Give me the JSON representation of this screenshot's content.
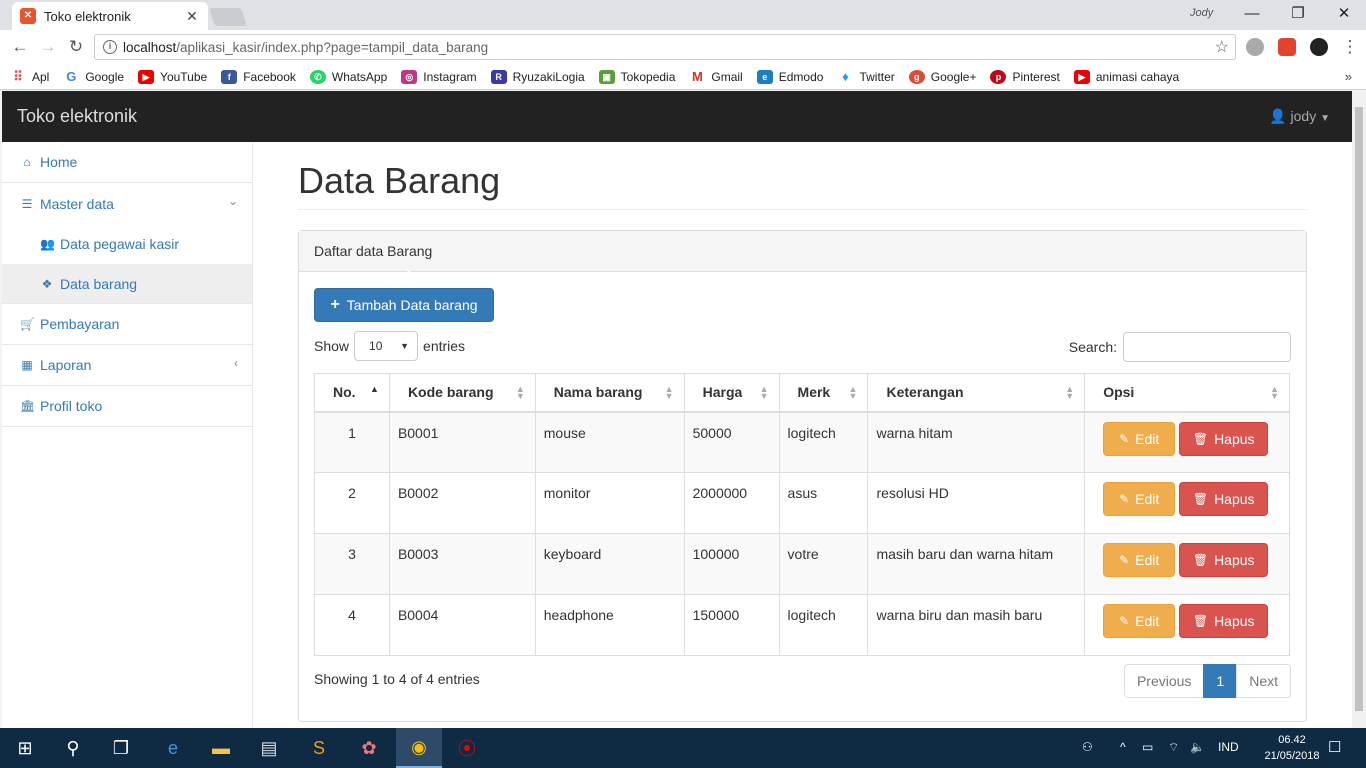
{
  "browser": {
    "tab_title": "Toko elektronik",
    "window_user": "Jody",
    "url_host": "localhost",
    "url_path": "/aplikasi_kasir/index.php?page=tampil_data_barang",
    "bookmarks": [
      {
        "label": "Apl"
      },
      {
        "label": "Google"
      },
      {
        "label": "YouTube"
      },
      {
        "label": "Facebook"
      },
      {
        "label": "WhatsApp"
      },
      {
        "label": "Instagram"
      },
      {
        "label": "RyuzakiLogia"
      },
      {
        "label": "Tokopedia"
      },
      {
        "label": "Gmail"
      },
      {
        "label": "Edmodo"
      },
      {
        "label": "Twitter"
      },
      {
        "label": "Google+"
      },
      {
        "label": "Pinterest"
      },
      {
        "label": "animasi cahaya"
      }
    ]
  },
  "app": {
    "brand": "Toko elektronik",
    "user": "jody"
  },
  "sidebar": {
    "home": "Home",
    "master": "Master data",
    "pegawai": "Data pegawai kasir",
    "barang": "Data barang",
    "pembayaran": "Pembayaran",
    "laporan": "Laporan",
    "profil": "Profil toko"
  },
  "page": {
    "title": "Data Barang",
    "panel_title": "Daftar data Barang",
    "add_button": "Tambah Data barang",
    "show_label": "Show",
    "entries_label": "entries",
    "entries_value": "10",
    "search_label": "Search:",
    "info": "Showing 1 to 4 of 4 entries",
    "prev": "Previous",
    "page_num": "1",
    "next": "Next",
    "edit_label": "Edit",
    "delete_label": "Hapus"
  },
  "table": {
    "headers": [
      "No.",
      "Kode barang",
      "Nama barang",
      "Harga",
      "Merk",
      "Keterangan",
      "Opsi"
    ],
    "rows": [
      {
        "no": "1",
        "kode": "B0001",
        "nama": "mouse",
        "harga": "50000",
        "merk": "logitech",
        "ket": "warna hitam"
      },
      {
        "no": "2",
        "kode": "B0002",
        "nama": "monitor",
        "harga": "2000000",
        "merk": "asus",
        "ket": "resolusi HD"
      },
      {
        "no": "3",
        "kode": "B0003",
        "nama": "keyboard",
        "harga": "100000",
        "merk": "votre",
        "ket": "masih baru dan warna hitam"
      },
      {
        "no": "4",
        "kode": "B0004",
        "nama": "headphone",
        "harga": "150000",
        "merk": "logitech",
        "ket": "warna biru dan masih baru"
      }
    ]
  },
  "taskbar": {
    "lang": "IND",
    "time": "06.42",
    "date": "21/05/2018"
  }
}
